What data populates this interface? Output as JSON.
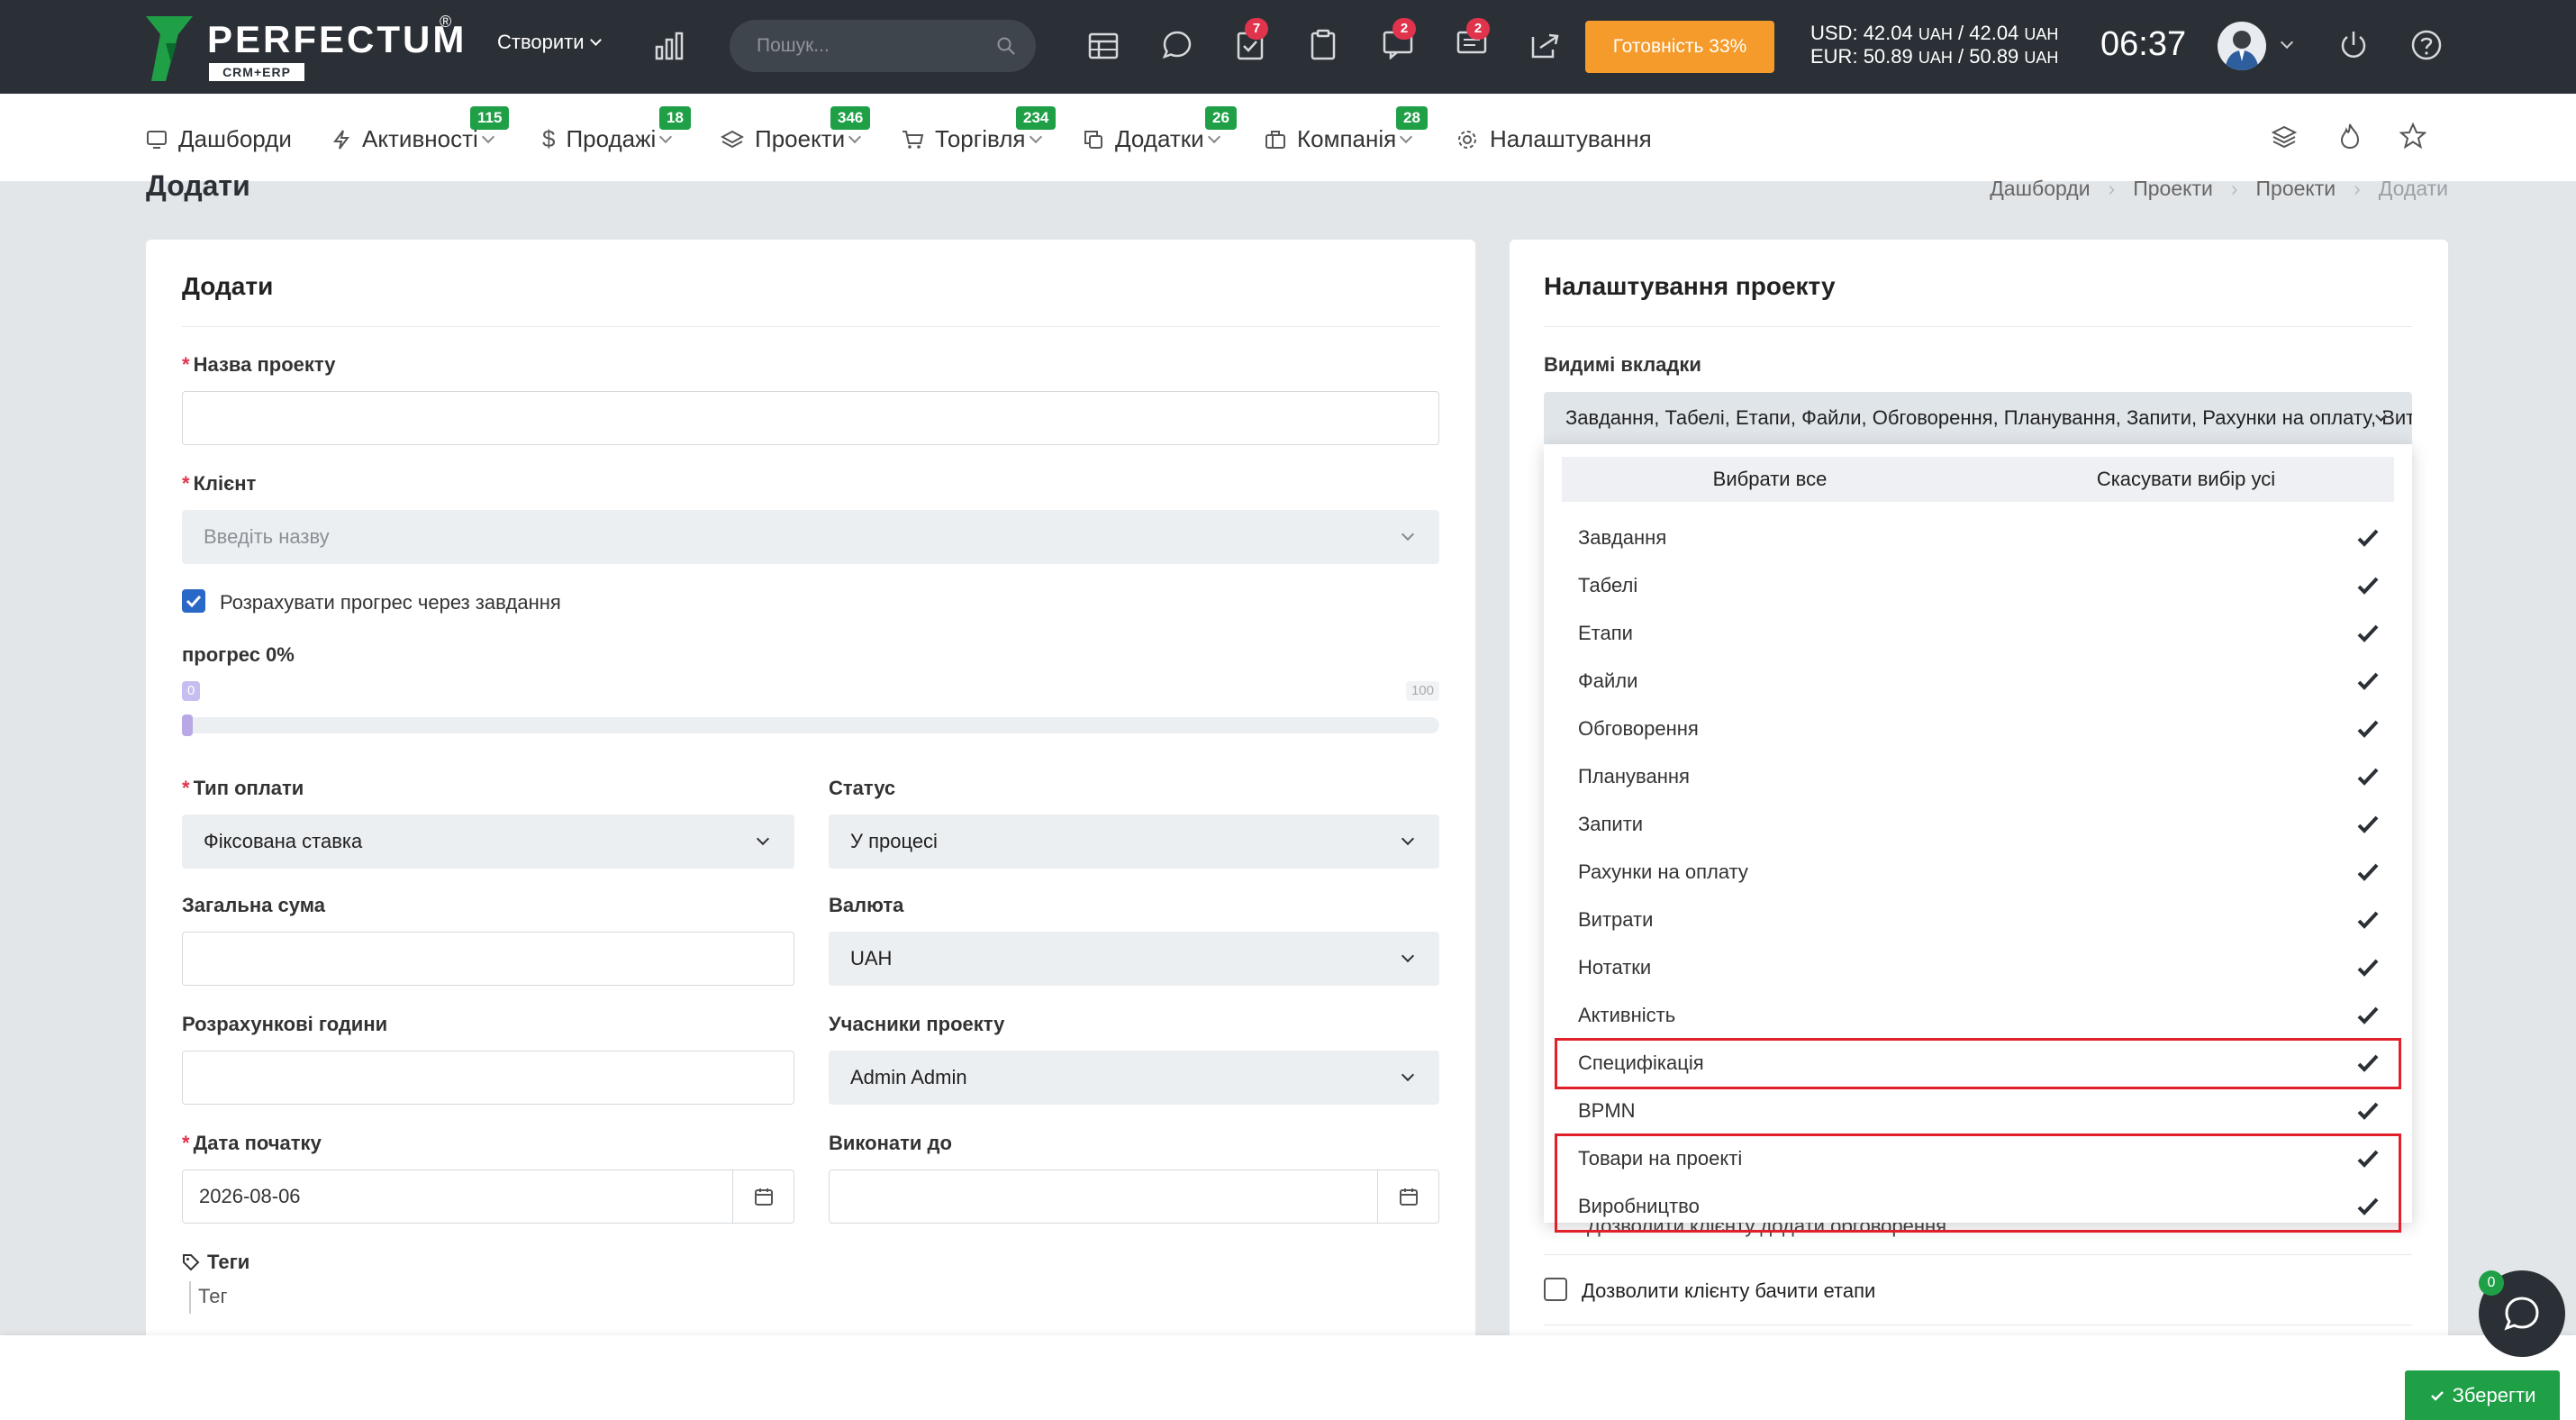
{
  "app": {
    "logo_text": "PERFECTUM",
    "logo_reg": "®",
    "logo_sub": "CRM+ERP"
  },
  "topbar": {
    "create_label": "Створити",
    "search_placeholder": "Пошук...",
    "badges": {
      "tasks": "7",
      "notifications": "2",
      "messages": "2"
    },
    "ready_label": "Готовність 33%",
    "fx_usd": {
      "label": "USD:",
      "buy": "42.04",
      "sell": "42.04",
      "currency": "UAH"
    },
    "fx_eur": {
      "label": "EUR:",
      "buy": "50.89",
      "sell": "50.89",
      "currency": "UAH"
    },
    "time": "06:37"
  },
  "nav": {
    "items": [
      {
        "label": "Дашборди",
        "badge": ""
      },
      {
        "label": "Активності",
        "badge": "115"
      },
      {
        "label": "Продажі",
        "badge": "18"
      },
      {
        "label": "Проекти",
        "badge": "346"
      },
      {
        "label": "Торгівля",
        "badge": "234"
      },
      {
        "label": "Додатки",
        "badge": "26"
      },
      {
        "label": "Компанія",
        "badge": "28"
      },
      {
        "label": "Налаштування",
        "badge": ""
      }
    ]
  },
  "page": {
    "title": "Додати",
    "breadcrumb": [
      "Дашборди",
      "Проекти",
      "Проекти",
      "Додати"
    ]
  },
  "form": {
    "card_title": "Додати",
    "project_name_label": "Назва проекту",
    "project_name_value": "",
    "client_label": "Клієнт",
    "client_placeholder": "Введіть назву",
    "calc_progress_label": "Розрахувати прогрес через завдання",
    "calc_progress_checked": true,
    "progress_label": "прогрес 0%",
    "progress_value": 0,
    "progress_min": "0",
    "progress_max": "100",
    "billing_type_label": "Тип оплати",
    "billing_type_value": "Фіксована ставка",
    "status_label": "Статус",
    "status_value": "У процесі",
    "total_label": "Загальна сума",
    "total_value": "",
    "currency_label": "Валюта",
    "currency_value": "UAH",
    "hours_label": "Розрахункові години",
    "hours_value": "",
    "members_label": "Учасники проекту",
    "members_value": "Admin Admin",
    "start_date_label": "Дата початку",
    "start_date_value": "2026-08-06",
    "deadline_label": "Виконати до",
    "deadline_value": "",
    "tags_label": "Теги",
    "tags_placeholder": "Тег"
  },
  "settings": {
    "card_title": "Налаштування проекту",
    "visible_tabs_label": "Видимі вкладки",
    "visible_tabs_value": "Завдання, Табелі, Етапи, Файли, Обговорення, Планування, Запити, Рахунки на оплату, Витрати, Нотатки, Активність, Специфікація, BPMN, Товари на проекті, Виробництво",
    "select_all": "Вибрати все",
    "deselect_all": "Скасувати вибір усі",
    "options": [
      {
        "label": "Завдання",
        "selected": true,
        "highlighted": false
      },
      {
        "label": "Табелі",
        "selected": true,
        "highlighted": false
      },
      {
        "label": "Етапи",
        "selected": true,
        "highlighted": false
      },
      {
        "label": "Файли",
        "selected": true,
        "highlighted": false
      },
      {
        "label": "Обговорення",
        "selected": true,
        "highlighted": false
      },
      {
        "label": "Планування",
        "selected": true,
        "highlighted": false
      },
      {
        "label": "Запити",
        "selected": true,
        "highlighted": false
      },
      {
        "label": "Рахунки на оплату",
        "selected": true,
        "highlighted": false
      },
      {
        "label": "Витрати",
        "selected": true,
        "highlighted": false
      },
      {
        "label": "Нотатки",
        "selected": true,
        "highlighted": false
      },
      {
        "label": "Активність",
        "selected": true,
        "highlighted": false
      },
      {
        "label": "Специфікація",
        "selected": true,
        "highlighted": true
      },
      {
        "label": "BPMN",
        "selected": true,
        "highlighted": false
      },
      {
        "label": "Товари на проекті",
        "selected": true,
        "highlighted": true
      },
      {
        "label": "Виробництво",
        "selected": true,
        "highlighted": true
      }
    ],
    "allow_discussions_label": "Дозволити клієнту додати обговорення",
    "allow_milestones_label": "Дозволити клієнту бачити етапи",
    "allow_milestones_checked": false
  },
  "footer": {
    "save_label": "Зберегти",
    "chat_badge": "0"
  },
  "colors": {
    "topbar_bg": "#2b3036",
    "accent_orange": "#f59b2b",
    "badge_green": "#1fa047",
    "badge_red": "#e0334c",
    "highlight_red": "#e1202a",
    "checkbox_blue": "#2a68c8"
  }
}
